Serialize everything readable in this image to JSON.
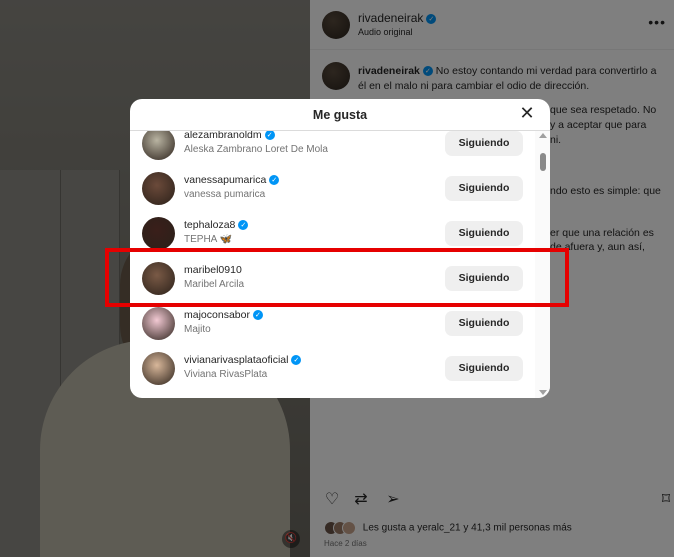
{
  "post": {
    "username": "rivadeneirak",
    "audio": "Audio original",
    "caption_user": "rivadeneirak",
    "caption_lines": [
      "No estoy contando mi verdad para convertirlo a",
      "él en el malo ni para cambiar el odio de dirección."
    ],
    "caption_fragments": [
      "que sea respetado. No",
      "y a aceptar que para",
      "ni.",
      "ndo esto es simple: que",
      "er que una relación es",
      "de afuera y, aun así,"
    ],
    "likes_text": "Les gusta a yeralc_21 y 41,3 mil personas más",
    "time_text": "Hace 2 días"
  },
  "modal": {
    "title": "Me gusta",
    "close_icon": "close-icon",
    "users": [
      {
        "username": "alezambranoldm",
        "full_name": "Aleska Zambrano Loret De Mola",
        "verified": true,
        "button": "Siguiendo",
        "avatar_color": "#b9b4a2"
      },
      {
        "username": "vanessapumarica",
        "full_name": "vanessa pumarica",
        "verified": true,
        "button": "Siguiendo",
        "avatar_color": "#6b4a3a"
      },
      {
        "username": "tephaloza8",
        "full_name": "TEPHA 🦋",
        "verified": true,
        "button": "Siguiendo",
        "avatar_color": "#3a1f1a"
      },
      {
        "username": "maribel0910",
        "full_name": "Maribel Arcila",
        "verified": false,
        "button": "Siguiendo",
        "avatar_color": "#7a5a46"
      },
      {
        "username": "majoconsabor",
        "full_name": "Majito",
        "verified": true,
        "button": "Siguiendo",
        "avatar_color": "#f2c9d3"
      },
      {
        "username": "vivianarivasplataoficial",
        "full_name": "Viviana RivasPlata",
        "verified": true,
        "button": "Siguiendo",
        "avatar_color": "#d8b79a"
      }
    ]
  },
  "colors": {
    "accent_verified": "#0095f6",
    "highlight_border": "#e60000",
    "button_bg": "#efefef"
  }
}
